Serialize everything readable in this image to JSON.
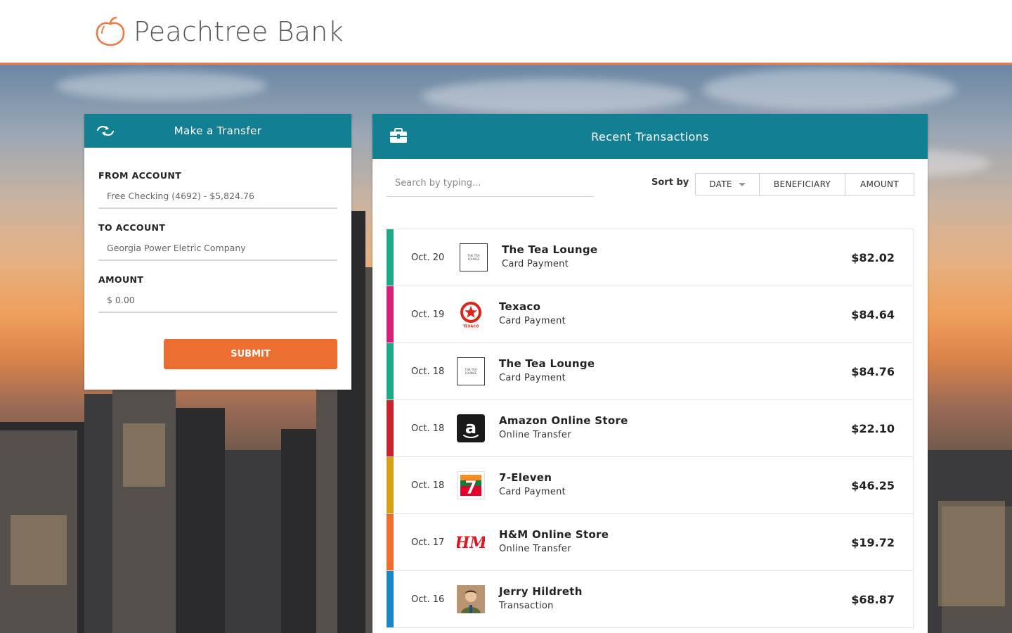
{
  "brand": {
    "name": "Peachtree Bank",
    "logo_icon": "peach-icon"
  },
  "colors": {
    "accent_orange": "#ec6d30",
    "panel_teal": "#127f93"
  },
  "transfer": {
    "title": "Make a Transfer",
    "icon": "transfer-arrows-icon",
    "from_label": "FROM ACCOUNT",
    "from_value": "Free Checking (4692) - $5,824.76",
    "to_label": "TO ACCOUNT",
    "to_value": "Georgia Power Eletric Company",
    "amount_label": "AMOUNT",
    "amount_placeholder": "$ 0.00",
    "submit_label": "SUBMIT"
  },
  "recent": {
    "title": "Recent Transactions",
    "icon": "briefcase-icon",
    "search_placeholder": "Search by typing...",
    "sort_label": "Sort by",
    "sort_options": [
      "DATE",
      "BENEFICIARY",
      "AMOUNT"
    ],
    "sort_active": "DATE",
    "transactions": [
      {
        "date": "Oct. 20",
        "merchant": "The Tea Lounge",
        "type": "Card Payment",
        "amount": "$82.02",
        "color": "#1fa883",
        "logo": "tea-lounge-logo"
      },
      {
        "date": "Oct. 19",
        "merchant": "Texaco",
        "type": "Card Payment",
        "amount": "$84.64",
        "color": "#d6217a",
        "logo": "texaco-logo"
      },
      {
        "date": "Oct. 18",
        "merchant": "The Tea Lounge",
        "type": "Card Payment",
        "amount": "$84.76",
        "color": "#1fa883",
        "logo": "tea-lounge-logo"
      },
      {
        "date": "Oct. 18",
        "merchant": "Amazon Online Store",
        "type": "Online Transfer",
        "amount": "$22.10",
        "color": "#c8242b",
        "logo": "amazon-logo"
      },
      {
        "date": "Oct. 18",
        "merchant": "7-Eleven",
        "type": "Card Payment",
        "amount": "$46.25",
        "color": "#d4a017",
        "logo": "seven-eleven-logo"
      },
      {
        "date": "Oct. 17",
        "merchant": "H&M Online Store",
        "type": "Online Transfer",
        "amount": "$19.72",
        "color": "#ec6d30",
        "logo": "hm-logo"
      },
      {
        "date": "Oct. 16",
        "merchant": "Jerry Hildreth",
        "type": "Transaction",
        "amount": "$68.87",
        "color": "#1a86c4",
        "logo": "person-avatar"
      }
    ]
  }
}
